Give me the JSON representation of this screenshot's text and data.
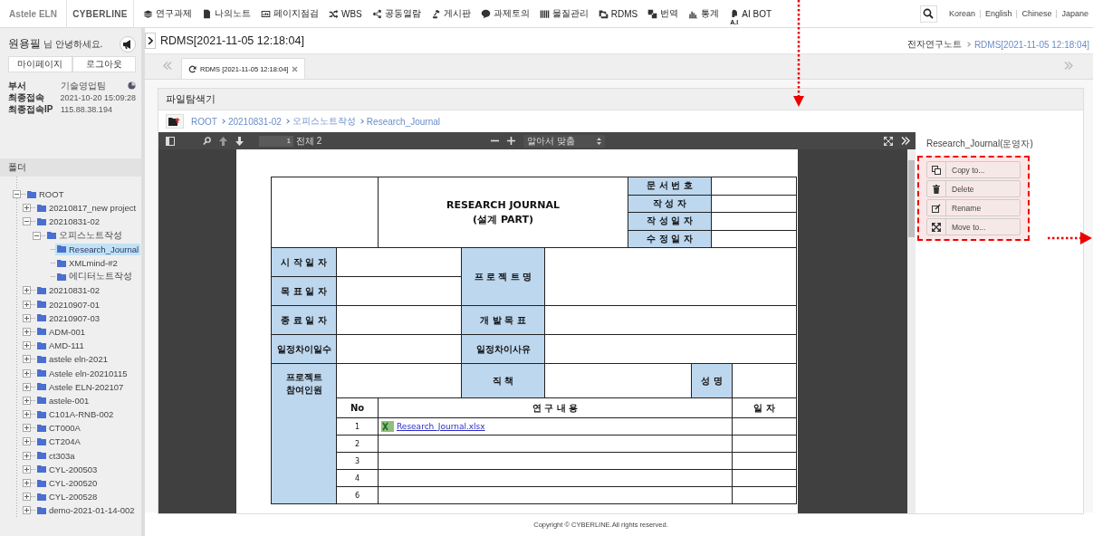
{
  "top_nav": {
    "logo": "Astele ELN",
    "brand": "CYBERLINE",
    "menu": [
      {
        "label": "연구과제"
      },
      {
        "label": "나의노트"
      },
      {
        "label": "페이지점검"
      },
      {
        "label": "WBS"
      },
      {
        "label": "공동열람"
      },
      {
        "label": "게시판"
      },
      {
        "label": "과제토의"
      },
      {
        "label": "물질관리"
      },
      {
        "label": "RDMS"
      },
      {
        "label": "번역"
      },
      {
        "label": "통계"
      },
      {
        "label": "AI BOT",
        "icon_caption": "A.I"
      }
    ],
    "languages": [
      "Korean",
      "English",
      "Chinese",
      "Japane"
    ]
  },
  "sidebar": {
    "user_name": "원용필",
    "greeting": "님 안녕하세요.",
    "buttons": [
      "마이페이지",
      "로그아웃"
    ],
    "info": [
      {
        "label": "부서",
        "value": "기술영업팀"
      },
      {
        "label": "최종접속",
        "value": "2021-10-20 15:09:28"
      },
      {
        "label": "최종접속IP",
        "value": "115.88.38.194"
      }
    ],
    "folder_title": "폴더",
    "tree": [
      {
        "label": "ROOT",
        "expanded": true,
        "selected": false,
        "children": [
          {
            "label": "20210817_new project",
            "expanded": false,
            "selected": false
          },
          {
            "label": "20210831-02",
            "expanded": true,
            "selected": false,
            "children": [
              {
                "label": "오피스노트작성",
                "expanded": true,
                "selected": false,
                "children": [
                  {
                    "label": "Research_Journal",
                    "selected": true
                  },
                  {
                    "label": "XMLmind-#2",
                    "selected": false
                  },
                  {
                    "label": "에디터노트작성",
                    "selected": false
                  }
                ]
              }
            ]
          },
          {
            "label": "20210831-02",
            "expanded": false,
            "selected": false
          },
          {
            "label": "20210907-01",
            "expanded": false,
            "selected": false
          },
          {
            "label": "20210907-03",
            "expanded": false,
            "selected": false
          },
          {
            "label": "ADM-001",
            "expanded": false,
            "selected": false
          },
          {
            "label": "AMD-111",
            "expanded": false,
            "selected": false
          },
          {
            "label": "astele eln-2021",
            "expanded": false,
            "selected": false
          },
          {
            "label": "Astele eln-20210115",
            "expanded": false,
            "selected": false
          },
          {
            "label": "Astele ELN-202107",
            "expanded": false,
            "selected": false
          },
          {
            "label": "astele-001",
            "expanded": false,
            "selected": false
          },
          {
            "label": "C101A-RNB-002",
            "expanded": false,
            "selected": false
          },
          {
            "label": "CT000A",
            "expanded": false,
            "selected": false
          },
          {
            "label": "CT204A",
            "expanded": false,
            "selected": false
          },
          {
            "label": "ct303a",
            "expanded": false,
            "selected": false
          },
          {
            "label": "CYL-200503",
            "expanded": false,
            "selected": false
          },
          {
            "label": "CYL-200520",
            "expanded": false,
            "selected": false
          },
          {
            "label": "CYL-200528",
            "expanded": false,
            "selected": false
          },
          {
            "label": "demo-2021-01-14-002",
            "expanded": false,
            "selected": false
          }
        ]
      }
    ]
  },
  "page_header": {
    "title": "RDMS[2021-11-05 12:18:04]",
    "breadcrumb": [
      "전자연구노트",
      "RDMS[2021-11-05 12:18:04]"
    ]
  },
  "tabs": [
    {
      "label": "RDMS [2021-11-05 12:18:04]",
      "selected": true
    }
  ],
  "file_explorer": {
    "title": "파일탐색기",
    "path": [
      "ROOT",
      "20210831-02",
      "오피스노트작성",
      "Research_Journal"
    ],
    "viewer": {
      "page": "1",
      "page_total": "전체 2",
      "zoom": "알아서 맞춤",
      "document": {
        "title": "RESEARCH JOURNAL",
        "subtitle": "(설계 PART)",
        "meta_labels": [
          "문 서 번 호",
          "작 성 자",
          "작 성 일 자",
          "수 정 일 자"
        ],
        "left_labels": [
          "시 작 일 자",
          "목 표 일 자",
          "종 료 일 자",
          "일정차이일수",
          "프로젝트 참여인원"
        ],
        "right_labels": [
          "프 로 젝 트 명",
          "개 발 목 표",
          "일정차이사유",
          "직 책"
        ],
        "name_label": "성 명",
        "log_columns": [
          "No",
          "연 구 내 용",
          "일 자"
        ],
        "log_rows": [
          {
            "no": "1",
            "file": "Research_Journal.xlsx"
          },
          {
            "no": "2"
          },
          {
            "no": "3"
          },
          {
            "no": "4"
          },
          {
            "no": "6"
          }
        ]
      }
    },
    "file_panel": {
      "title": "Research_Journal(운영자)",
      "actions": [
        "Copy to...",
        "Delete",
        "Rename",
        "Move to..."
      ]
    }
  },
  "footer": "Copyright © CYBERLINE.All rights reserved."
}
